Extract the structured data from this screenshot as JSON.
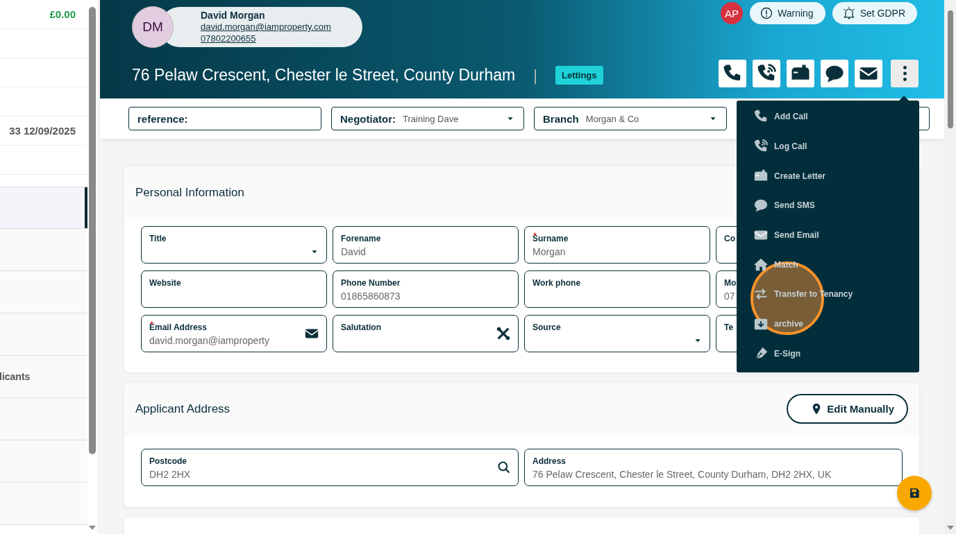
{
  "sidebar": {
    "top_rows": [
      {
        "kind": "amount",
        "text": "£0.00"
      },
      {
        "kind": "empty"
      },
      {
        "kind": "empty"
      },
      {
        "kind": "empty"
      },
      {
        "kind": "date",
        "text": "33 12/09/2025"
      },
      {
        "kind": "empty"
      }
    ],
    "rows": [
      {
        "selected": true
      },
      {
        "selected": false
      },
      {
        "selected": false
      },
      {
        "selected": false
      },
      {
        "selected": false,
        "text": "licants"
      },
      {
        "selected": false
      },
      {
        "selected": false
      },
      {
        "selected": false
      }
    ]
  },
  "header": {
    "contact": {
      "initials": "DM",
      "name": "David Morgan",
      "email": "david.morgan@iamproperty.com",
      "phone": "07802200655"
    },
    "user_initials": "AP",
    "pills": [
      {
        "kind": "warning",
        "label": "Warning"
      },
      {
        "kind": "bell",
        "label": "Set GDPR"
      }
    ],
    "title": "76 Pelaw Crescent, Chester le Street, County Durham",
    "separator": "|",
    "badge": "Lettings",
    "actions": [
      {
        "kind": "phone",
        "selected": false
      },
      {
        "kind": "log-call",
        "selected": false
      },
      {
        "kind": "letter",
        "selected": false
      },
      {
        "kind": "sms",
        "selected": false
      },
      {
        "kind": "email",
        "selected": false
      },
      {
        "kind": "more",
        "selected": true
      }
    ]
  },
  "filters": [
    {
      "kind": "text",
      "label": "reference:"
    },
    {
      "kind": "select",
      "label": "Negotiator:",
      "value": "Training Dave"
    },
    {
      "kind": "select",
      "label": "Branch",
      "value": "Morgan & Co"
    },
    {
      "kind": "text"
    }
  ],
  "menu": [
    {
      "kind": "phone",
      "label": "Add Call"
    },
    {
      "kind": "log-call",
      "label": "Log Call"
    },
    {
      "kind": "letter",
      "label": "Create Letter"
    },
    {
      "kind": "sms",
      "label": "Send SMS"
    },
    {
      "kind": "email",
      "label": "Send Email"
    },
    {
      "kind": "match",
      "label": "Match"
    },
    {
      "kind": "transfer",
      "label": "Transfer to Tenancy"
    },
    {
      "kind": "archive",
      "label": "archive"
    },
    {
      "kind": "esign",
      "label": "E-Sign"
    }
  ],
  "personal_information": {
    "title": "Personal Information",
    "fields": [
      {
        "kind": "select",
        "label": "Title",
        "required": false
      },
      {
        "kind": "text",
        "label": "Forename",
        "value": "David",
        "required": false
      },
      {
        "kind": "text",
        "label": "Surname",
        "value": "Morgan",
        "required": true
      },
      {
        "kind": "text",
        "label": "Co",
        "required": false
      },
      {
        "kind": "text",
        "label": "Website",
        "required": false
      },
      {
        "kind": "text",
        "label": "Phone Number",
        "value": "01865860873",
        "required": false
      },
      {
        "kind": "text",
        "label": "Work phone",
        "required": false
      },
      {
        "kind": "text",
        "label": "Mo",
        "value": "07",
        "required": false
      },
      {
        "kind": "email",
        "label": "Email Address",
        "value": "david.morgan@iamproperty",
        "required": true
      },
      {
        "kind": "tools",
        "label": "Salutation",
        "required": false
      },
      {
        "kind": "select",
        "label": "Source",
        "required": false
      },
      {
        "kind": "text",
        "label": "Te",
        "required": false
      }
    ]
  },
  "applicant_address": {
    "title": "Applicant Address",
    "button": "Edit Manually",
    "fields": [
      {
        "kind": "search",
        "label": "Postcode",
        "value": "DH2 2HX",
        "required": false
      },
      {
        "kind": "text",
        "label": "Address",
        "value": "76 Pelaw Crescent, Chester le Street, County Durham, DH2 2HX, UK",
        "required": false
      }
    ]
  }
}
